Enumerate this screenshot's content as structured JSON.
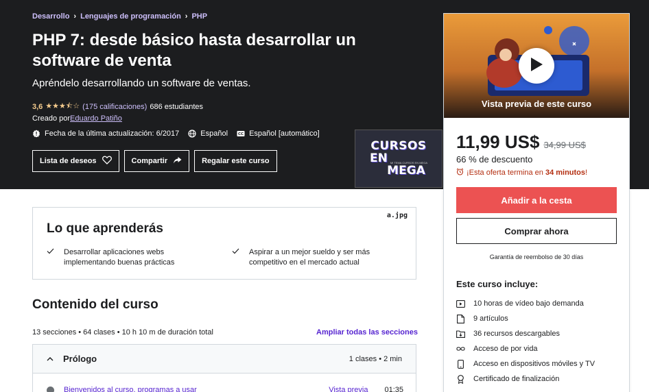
{
  "breadcrumb": {
    "items": [
      "Desarrollo",
      "Lenguajes de programación",
      "PHP"
    ],
    "separator": "›"
  },
  "course": {
    "title": "PHP 7: desde básico hasta desarrollar un software de venta",
    "subtitle": "Apréndelo desarrollando un software de ventas.",
    "rating": "3,6",
    "stars": "★★★⯪☆",
    "ratings_count": "(175 calificaciones)",
    "students": "686 estudiantes",
    "created_by_label": "Creado por",
    "author": "Eduardo Patiño",
    "last_updated": "Fecha de la última actualización: 6/2017",
    "language": "Español",
    "captions": "Español [automático]"
  },
  "hero_buttons": {
    "wishlist": "Lista de deseos",
    "share": "Compartir",
    "gift": "Regalar este curso"
  },
  "watermark": {
    "line1": "CURSOS",
    "line2": "EN",
    "line3": "MEGA",
    "small": "MI TEMA CURSOS EN MEGA"
  },
  "sidebar": {
    "preview_label": "Vista previa de este curso",
    "price": "11,99 US$",
    "old_price": "34,99 US$",
    "discount": "66 % de descuento",
    "offer_prefix": "¡Esta oferta termina en ",
    "offer_time": "34 minutos",
    "offer_suffix": "!",
    "add_to_cart": "Añadir a la cesta",
    "buy_now": "Comprar ahora",
    "guarantee": "Garantía de reembolso de 30 días",
    "includes_title": "Este curso incluye:",
    "includes": [
      {
        "icon": "video-icon",
        "text": "10 horas de vídeo bajo demanda"
      },
      {
        "icon": "file-icon",
        "text": "9 artículos"
      },
      {
        "icon": "folder-download-icon",
        "text": "36 recursos descargables"
      },
      {
        "icon": "infinity-icon",
        "text": "Acceso de por vida"
      },
      {
        "icon": "mobile-icon",
        "text": "Acceso en dispositivos móviles y TV"
      },
      {
        "icon": "certificate-icon",
        "text": "Certificado de finalización"
      }
    ]
  },
  "learn": {
    "title": "Lo que aprenderás",
    "tag": "a.jpg",
    "items": [
      "Desarrollar aplicaciones webs implementando buenas prácticas",
      "Aspirar a un mejor sueldo y ser más competitivo en el mercado actual"
    ]
  },
  "content": {
    "title": "Contenido del curso",
    "meta": "13 secciones • 64 clases • 10 h 10 m de duración total",
    "expand_all": "Ampliar todas las secciones",
    "section": {
      "name": "Prólogo",
      "info": "1 clases • 2 min"
    },
    "lecture": {
      "title": "Bienvenidos al curso, programas a usar",
      "preview": "Vista previa",
      "duration": "01:35"
    }
  },
  "colors": {
    "hero_bg": "#1c1d1f",
    "link_purple": "#cec0fc",
    "star": "#f3ca8c",
    "cart_red": "#ec5252",
    "accent_purple": "#5624d0"
  }
}
